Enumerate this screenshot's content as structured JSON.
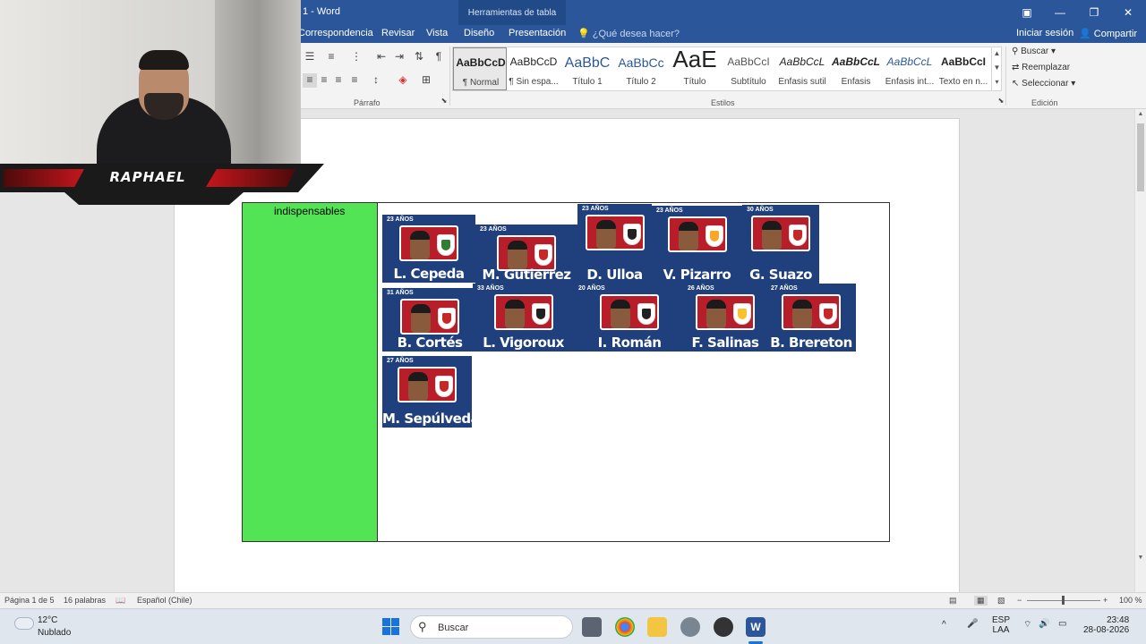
{
  "titlebar": {
    "doc_title": "1 - Word",
    "context_tab": "Herramientas de tabla",
    "restore_icon": "ribbon-display-icon",
    "min": "—",
    "max": "❐",
    "close": "✕"
  },
  "tabs": {
    "items": [
      "Correspondencia",
      "Revisar",
      "Vista",
      "Diseño",
      "Presentación"
    ],
    "tell_me": "¿Qué desea hacer?",
    "signin": "Iniciar sesión",
    "share": "Compartir"
  },
  "ribbon": {
    "group_parrafo": "Párrafo",
    "group_estilos": "Estilos",
    "group_edicion": "Edición",
    "styles": [
      {
        "sample": "AaBbCcD",
        "name": "¶ Normal"
      },
      {
        "sample": "AaBbCcD",
        "name": "¶ Sin espa..."
      },
      {
        "sample": "AaBbC",
        "name": "Título 1"
      },
      {
        "sample": "AaBbCc",
        "name": "Título 2"
      },
      {
        "sample": "AaE",
        "name": "Título"
      },
      {
        "sample": "AaBbCcI",
        "name": "Subtítulo"
      },
      {
        "sample": "AaBbCcL",
        "name": "Énfasis sutil"
      },
      {
        "sample": "AaBbCcL",
        "name": "Énfasis"
      },
      {
        "sample": "AaBbCcL",
        "name": "Énfasis int..."
      },
      {
        "sample": "AaBbCcI",
        "name": "Texto en n..."
      }
    ],
    "edit": {
      "buscar": "Buscar",
      "reemplazar": "Reemplazar",
      "seleccionar": "Seleccionar"
    }
  },
  "webcam": {
    "streamer_name": "RAPHAEL"
  },
  "document": {
    "green_label": "indispensables",
    "players": [
      {
        "age": "23 AÑOS",
        "name": "L. Cepeda",
        "club_color": "#2e7d32"
      },
      {
        "age": "23 AÑOS",
        "name": "M. Gutierrez",
        "club_color": "#c62828"
      },
      {
        "age": "23 AÑOS",
        "name": "D. Ulloa",
        "club_color": "#212121"
      },
      {
        "age": "23 AÑOS",
        "name": "V. Pizarro",
        "club_color": "#f9a825"
      },
      {
        "age": "30 AÑOS",
        "name": "G. Suazo",
        "club_color": "#c62828"
      },
      {
        "age": "31 AÑOS",
        "name": "B. Cortés",
        "club_color": "#c62828"
      },
      {
        "age": "33 AÑOS",
        "name": "L. Vigoroux",
        "club_color": "#212121"
      },
      {
        "age": "20 AÑOS",
        "name": "I. Román",
        "club_color": "#212121"
      },
      {
        "age": "26 AÑOS",
        "name": "F. Salinas",
        "club_color": "#fbc02d"
      },
      {
        "age": "27 AÑOS",
        "name": "B. Brereton",
        "club_color": "#c62828"
      },
      {
        "age": "27 AÑOS",
        "name": "M. Sepúlveda",
        "club_color": "#c62828"
      }
    ]
  },
  "statusbar": {
    "page": "Página 1 de 5",
    "words": "16 palabras",
    "language": "Español (Chile)",
    "zoom": "100 %"
  },
  "taskbar": {
    "temp": "12°C",
    "weather": "Nublado",
    "search": "Buscar",
    "lang_1": "ESP",
    "lang_2": "LAA",
    "time": "23:48",
    "date": "28-08-2026"
  }
}
